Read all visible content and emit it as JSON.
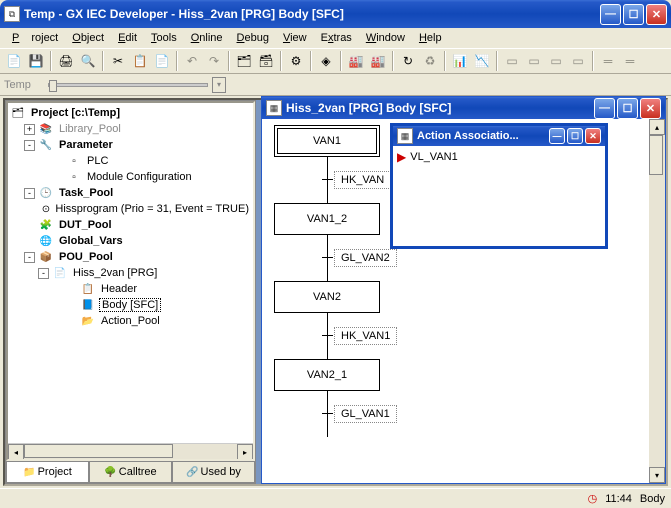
{
  "window": {
    "title": "Temp - GX IEC Developer - Hiss_2van [PRG] Body [SFC]"
  },
  "menu": [
    "Project",
    "Object",
    "Edit",
    "Tools",
    "Online",
    "Debug",
    "View",
    "Extras",
    "Window",
    "Help"
  ],
  "toolbar2_label": "Temp",
  "tree": {
    "root": "Project [c:\\Temp]",
    "items": [
      {
        "ind": 1,
        "tw": "+",
        "ic": "📚",
        "lbl": "Library_Pool",
        "gray": true
      },
      {
        "ind": 1,
        "tw": "-",
        "ic": "🔧",
        "lbl": "Parameter",
        "bold": true
      },
      {
        "ind": 3,
        "ic": "▫",
        "lbl": "PLC"
      },
      {
        "ind": 3,
        "ic": "▫",
        "lbl": "Module Configuration"
      },
      {
        "ind": 1,
        "tw": "-",
        "ic": "🕒",
        "lbl": "Task_Pool",
        "bold": true
      },
      {
        "ind": 3,
        "ic": "⊙",
        "lbl": "Hissprogram (Prio = 31, Event = TRUE)"
      },
      {
        "ind": 1,
        "ic": "🧩",
        "lbl": "DUT_Pool",
        "bold": true
      },
      {
        "ind": 1,
        "ic": "🌐",
        "lbl": "Global_Vars",
        "bold": true
      },
      {
        "ind": 1,
        "tw": "-",
        "ic": "📦",
        "lbl": "POU_Pool",
        "bold": true
      },
      {
        "ind": 2,
        "tw": "-",
        "ic": "📄",
        "lbl": "Hiss_2van [PRG]"
      },
      {
        "ind": 4,
        "ic": "📋",
        "lbl": "Header"
      },
      {
        "ind": 4,
        "ic": "📘",
        "lbl": "Body [SFC]",
        "sel": true
      },
      {
        "ind": 4,
        "ic": "📂",
        "lbl": "Action_Pool"
      }
    ]
  },
  "tree_tabs": [
    "Project",
    "Calltree",
    "Used by"
  ],
  "sfc_window_title": "Hiss_2van [PRG] Body [SFC]",
  "sfc": [
    {
      "type": "step",
      "label": "VAN1",
      "initial": true
    },
    {
      "type": "trans",
      "label": "HK_VAN"
    },
    {
      "type": "step",
      "label": "VAN1_2"
    },
    {
      "type": "trans",
      "label": "GL_VAN2"
    },
    {
      "type": "step",
      "label": "VAN2"
    },
    {
      "type": "trans",
      "label": "HK_VAN1"
    },
    {
      "type": "step",
      "label": "VAN2_1"
    },
    {
      "type": "trans",
      "label": "GL_VAN1"
    }
  ],
  "action_window": {
    "title": "Action Associatio...",
    "item": "VL_VAN1"
  },
  "status": {
    "time": "11:44",
    "mode": "Body"
  }
}
